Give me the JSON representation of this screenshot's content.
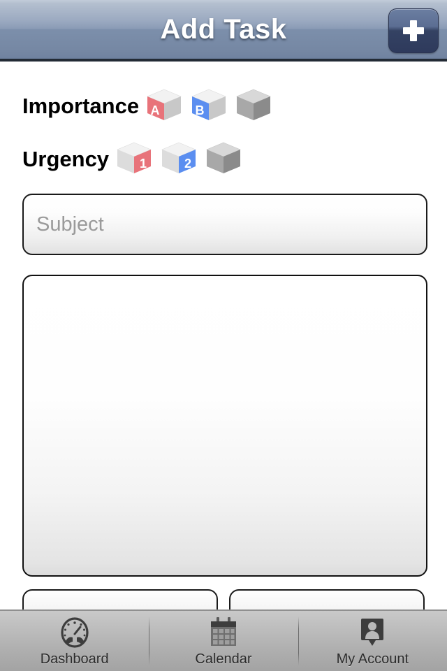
{
  "header": {
    "title": "Add Task",
    "add_button_label": "+",
    "add_button_icon": "plus-icon"
  },
  "form": {
    "importance": {
      "label": "Importance",
      "options": [
        {
          "value": "A",
          "color": "#e8737a",
          "filled": true,
          "side": "left",
          "icon": "cube-a-icon"
        },
        {
          "value": "B",
          "color": "#5b8ef0",
          "filled": true,
          "side": "left",
          "icon": "cube-b-icon"
        },
        {
          "value": "",
          "color": "#9a9a9a",
          "filled": false,
          "side": "none",
          "icon": "cube-plain-icon"
        }
      ]
    },
    "urgency": {
      "label": "Urgency",
      "options": [
        {
          "value": "1",
          "color": "#e8737a",
          "filled": true,
          "side": "right",
          "icon": "cube-1-icon"
        },
        {
          "value": "2",
          "color": "#5b8ef0",
          "filled": true,
          "side": "right",
          "icon": "cube-2-icon"
        },
        {
          "value": "",
          "color": "#9a9a9a",
          "filled": false,
          "side": "none",
          "icon": "cube-plain-icon"
        }
      ]
    },
    "subject": {
      "placeholder": "Subject",
      "value": ""
    },
    "notes": {
      "placeholder": "",
      "value": ""
    },
    "bottom_buttons": [
      {
        "label": ""
      },
      {
        "label": ""
      }
    ]
  },
  "tabbar": {
    "items": [
      {
        "label": "Dashboard",
        "icon": "gauge-icon",
        "selected": false
      },
      {
        "label": "Calendar",
        "icon": "calendar-icon",
        "selected": false
      },
      {
        "label": "My Account",
        "icon": "person-pin-icon",
        "selected": false
      }
    ]
  },
  "colors": {
    "header_top": "#b4bfcf",
    "header_bottom": "#7587a3",
    "header_border": "#232b35",
    "add_button": "#2e3a5c",
    "accent_a": "#e8737a",
    "accent_b": "#5b8ef0",
    "cube_gray": "#9a9a9a",
    "tabbar_bg": "#b6b6b6",
    "placeholder_text": "#9a9a9a"
  }
}
